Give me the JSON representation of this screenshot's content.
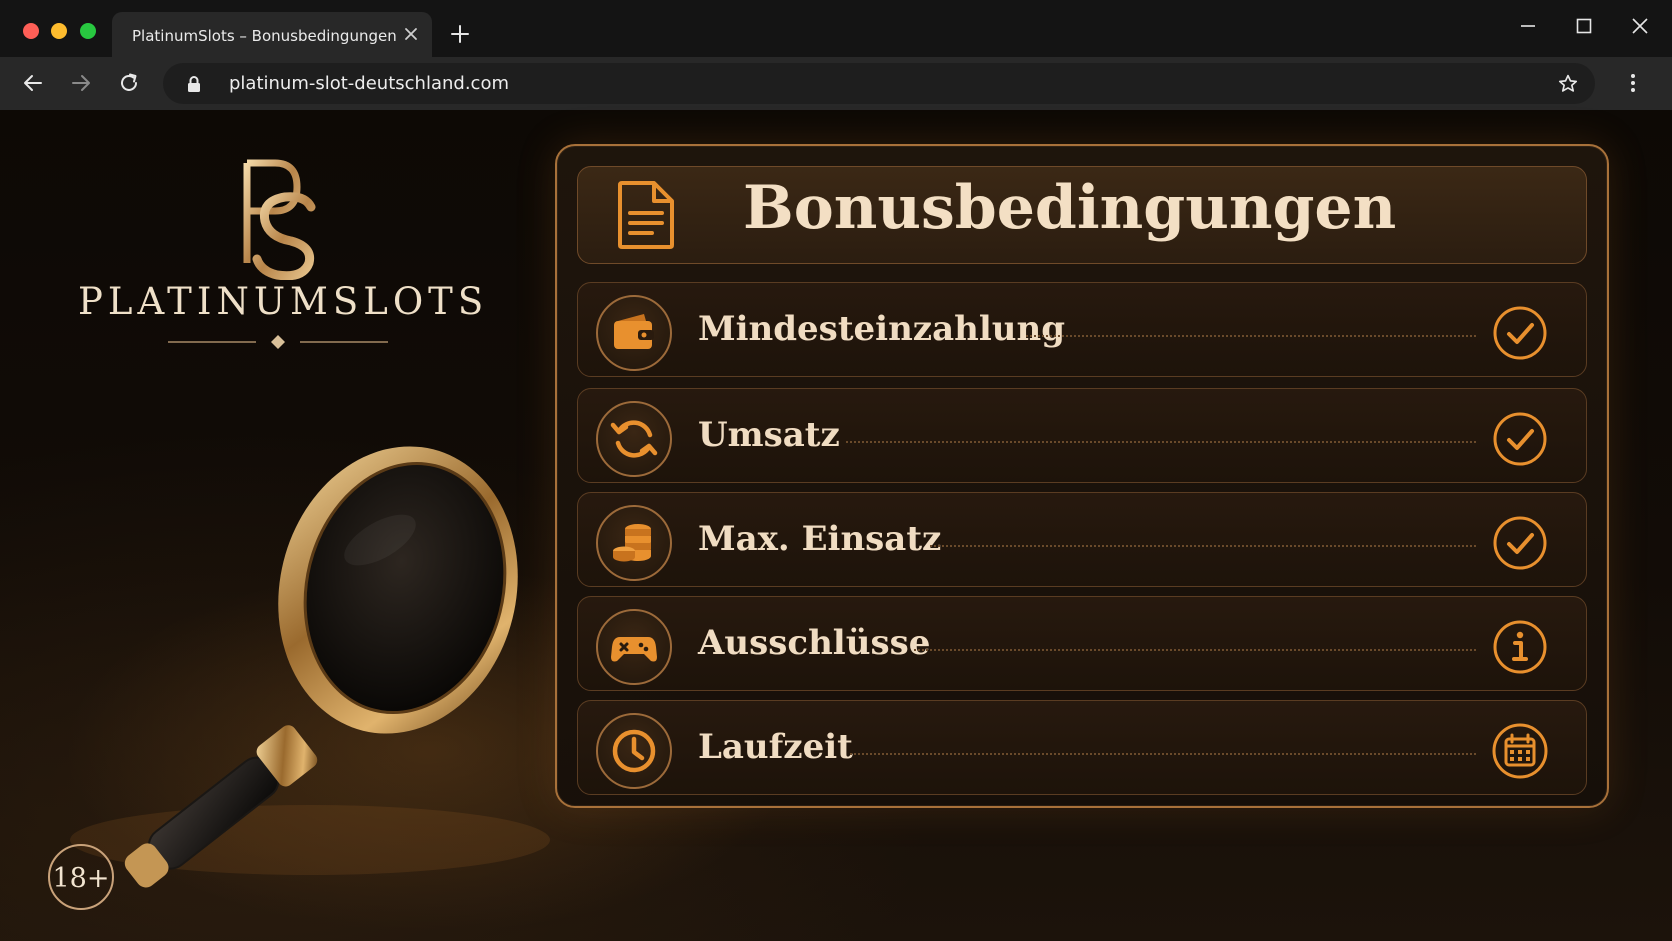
{
  "browser": {
    "tab_title": "PlatinumSlots – Bonusbedingungen",
    "url": "platinum-slot-deutschland.com"
  },
  "brand": {
    "logo_monogram": "PS",
    "name": "PLATINUMSLOTS",
    "age_badge": "18+"
  },
  "panel": {
    "title": "Bonusbedingungen",
    "title_icon": "document-icon",
    "rows": [
      {
        "label": "Mindesteinzahlung",
        "icon": "wallet-icon",
        "status_icon": "check-circle-icon"
      },
      {
        "label": "Umsatz",
        "icon": "refresh-icon",
        "status_icon": "check-circle-icon"
      },
      {
        "label": "Max. Einsatz",
        "icon": "coins-icon",
        "status_icon": "check-circle-icon"
      },
      {
        "label": "Ausschlüsse",
        "icon": "gamepad-icon",
        "status_icon": "info-circle-icon"
      },
      {
        "label": "Laufzeit",
        "icon": "clock-icon",
        "status_icon": "calendar-icon"
      }
    ]
  },
  "colors": {
    "accent": "#e8902e",
    "gold": "#c9a06a",
    "text_light": "#f0dcc2",
    "panel_border": "#a8713a"
  }
}
